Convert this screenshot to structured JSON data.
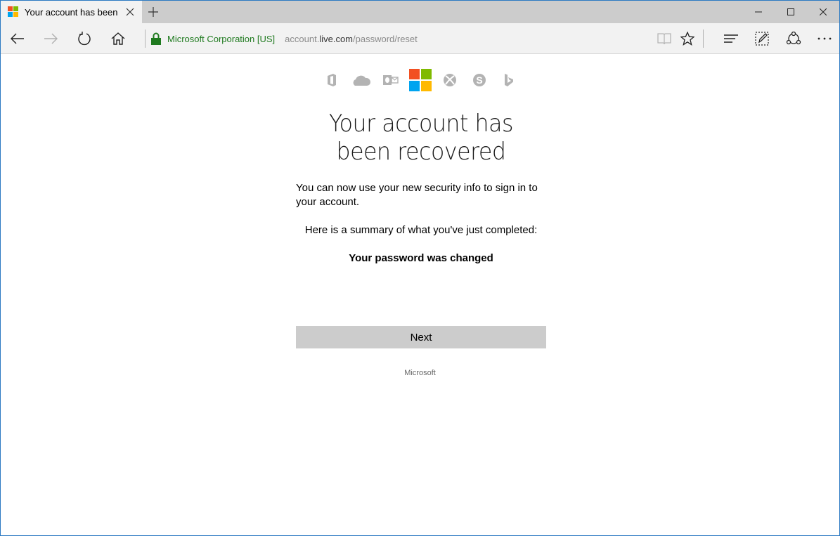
{
  "browser": {
    "tab": {
      "title": "Your account has been r",
      "favicon": "microsoft-logo-icon"
    },
    "window_controls": {
      "minimize": "minimize-icon",
      "maximize": "maximize-icon",
      "close": "close-icon"
    },
    "nav": {
      "back": "back-arrow-icon",
      "forward": "forward-arrow-icon",
      "refresh": "refresh-icon",
      "home": "home-icon"
    },
    "address": {
      "certificate": "Microsoft Corporation [US]",
      "url_prefix": "account.",
      "url_domain": "live.com",
      "url_path": "/password/reset"
    },
    "toolbar": {
      "reading_view": "reading-view-icon",
      "favorite": "star-icon",
      "hub": "hub-icon",
      "web_note": "web-note-icon",
      "share": "share-icon",
      "more": "more-icon"
    }
  },
  "colors": {
    "ms_red": "#f25022",
    "ms_green": "#7fba00",
    "ms_blue": "#00a4ef",
    "ms_yellow": "#ffb900",
    "cert_green": "#1f7a1f",
    "product_icon_gray": "#b3b3b3",
    "button_gray": "#cccccc"
  },
  "page": {
    "product_icons": [
      "office-icon",
      "onedrive-icon",
      "outlook-icon",
      "microsoft-logo-icon",
      "xbox-icon",
      "skype-icon",
      "bing-icon"
    ],
    "title": "Your account has been recovered",
    "message": "You can now use your new security info to sign in to your account.",
    "summary_intro": "Here is a summary of what you've just completed:",
    "summary_item": "Your password was changed",
    "next_button": "Next",
    "footer": "Microsoft"
  }
}
